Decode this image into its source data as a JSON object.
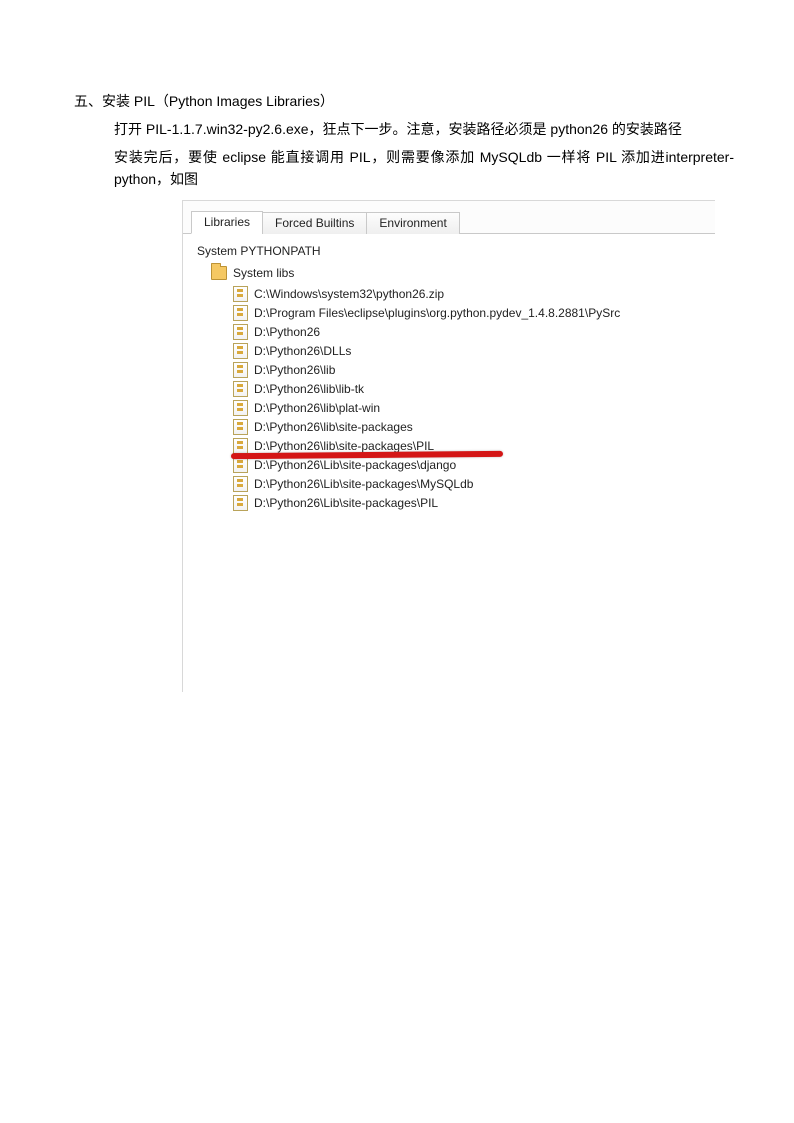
{
  "section": {
    "title": "五、安装 PIL（Python Images Libraries）",
    "para1": "打开  PIL-1.1.7.win32-py2.6.exe，狂点下一步。注意，安装路径必须是  python26  的安装路径",
    "para2": "安装完后，要使  eclipse  能直接调用  PIL，则需要像添加  MySQLdb  一样将  PIL  添加进interpreter-python，如图"
  },
  "tabs": {
    "t0": "Libraries",
    "t1": "Forced Builtins",
    "t2": "Environment"
  },
  "panel": {
    "heading": "System PYTHONPATH",
    "root": "System libs",
    "items": {
      "i0": "C:\\Windows\\system32\\python26.zip",
      "i1": "D:\\Program Files\\eclipse\\plugins\\org.python.pydev_1.4.8.2881\\PySrc",
      "i2": "D:\\Python26",
      "i3": "D:\\Python26\\DLLs",
      "i4": "D:\\Python26\\lib",
      "i5": "D:\\Python26\\lib\\lib-tk",
      "i6": "D:\\Python26\\lib\\plat-win",
      "i7": "D:\\Python26\\lib\\site-packages",
      "i8": "D:\\Python26\\lib\\site-packages\\PIL",
      "i9": "D:\\Python26\\Lib\\site-packages\\django",
      "i10": "D:\\Python26\\Lib\\site-packages\\MySQLdb",
      "i11": "D:\\Python26\\Lib\\site-packages\\PIL"
    }
  }
}
